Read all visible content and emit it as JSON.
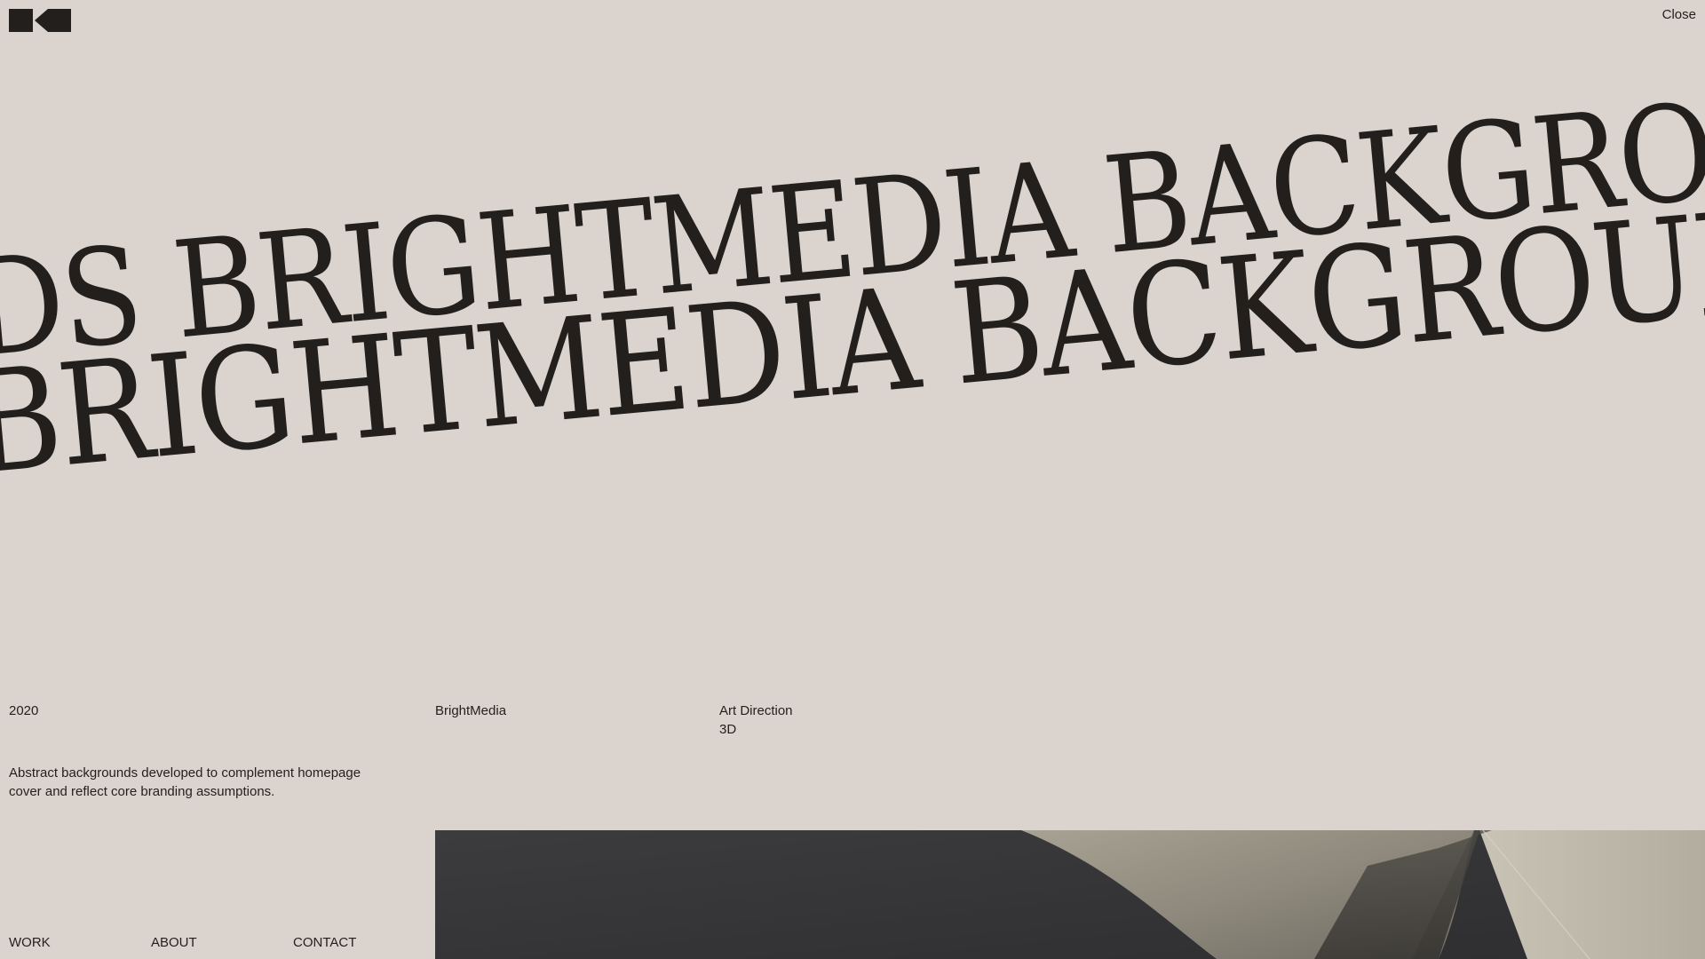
{
  "header": {
    "logo_icon": "brand-logo-mark",
    "close_label": "Close"
  },
  "marquee": {
    "line1": "DS BRIGHTMEDIA BACKGROUNDS BRIGHTMEDIA BACKGROUNDS",
    "line2": "BRIGHTMEDIA BACKGROUNDS BRIGHTMEDIA BACKGROUNDS"
  },
  "project": {
    "year": "2020",
    "client": "BrightMedia",
    "services": [
      "Art Direction",
      "3D"
    ],
    "description": "Abstract backgrounds developed to complement homepage cover and reflect core branding assumptions."
  },
  "nav": {
    "work": "WORK",
    "about": "ABOUT",
    "contact": "CONTACT"
  },
  "colors": {
    "background": "#dbd4ce",
    "text": "#231f1c",
    "image_dark": "#3a3a3c",
    "image_light": "#b8b2a6"
  }
}
